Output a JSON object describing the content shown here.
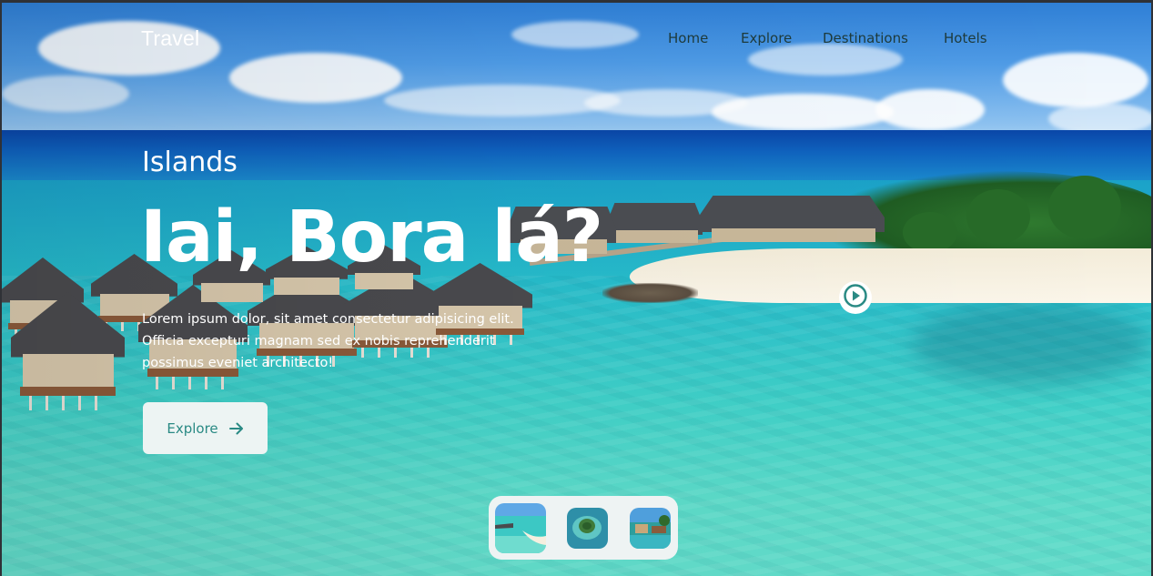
{
  "brand": {
    "logo": "Travel"
  },
  "nav": {
    "items": [
      {
        "label": "Home"
      },
      {
        "label": "Explore"
      },
      {
        "label": "Destinations"
      },
      {
        "label": "Hotels"
      }
    ]
  },
  "hero": {
    "eyebrow": "Islands",
    "title": "Iai, Bora lá?",
    "description": "Lorem ipsum dolor, sit amet consectetur adipisicing elit. Officia excepturi magnam sed ex nobis reprehenderit possimus eveniet architecto!",
    "cta": {
      "label": "Explore",
      "icon": "arrow-right-icon"
    },
    "play": {
      "icon": "play-circle-icon"
    }
  },
  "thumbnails": [
    {
      "name": "thumbnail-overwater-villas"
    },
    {
      "name": "thumbnail-island-aerial"
    },
    {
      "name": "thumbnail-resort-pool"
    }
  ],
  "colors": {
    "accent": "#2a8a84",
    "button_bg": "#edf4f3",
    "nav_text": "#1e3a3a",
    "hero_text": "#ffffff"
  }
}
